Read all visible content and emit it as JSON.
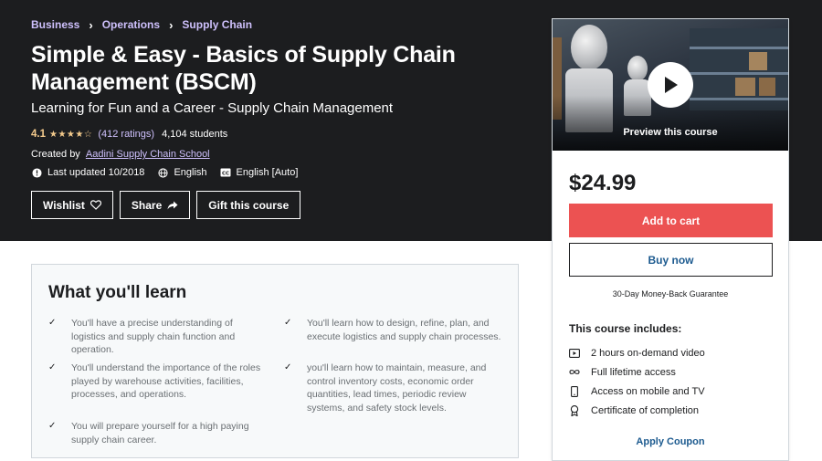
{
  "breadcrumb": [
    {
      "label": "Business"
    },
    {
      "label": "Operations"
    },
    {
      "label": "Supply Chain"
    }
  ],
  "course": {
    "title": "Simple & Easy - Basics of Supply Chain Management (BSCM)",
    "subtitle": "Learning for Fun and a Career - Supply Chain Management",
    "rating": "4.1",
    "stars": "★★★★☆",
    "ratings_count": "(412 ratings)",
    "students": "4,104 students",
    "created_by_label": "Created by",
    "instructor": "Aadini Supply Chain School",
    "last_updated": "Last updated 10/2018",
    "language": "English",
    "captions": "English [Auto]"
  },
  "hero_buttons": {
    "wishlist": "Wishlist",
    "share": "Share",
    "gift": "Gift this course"
  },
  "sidebar": {
    "preview_label": "Preview this course",
    "price": "$24.99",
    "add_to_cart": "Add to cart",
    "buy_now": "Buy now",
    "guarantee": "30-Day Money-Back Guarantee",
    "includes_title": "This course includes:",
    "includes": [
      {
        "icon": "video-icon",
        "label": "2 hours on-demand video"
      },
      {
        "icon": "infinity-icon",
        "label": "Full lifetime access"
      },
      {
        "icon": "mobile-icon",
        "label": "Access on mobile and TV"
      },
      {
        "icon": "certificate-icon",
        "label": "Certificate of completion"
      }
    ],
    "apply_coupon": "Apply Coupon"
  },
  "learn": {
    "title": "What you'll learn",
    "items": [
      "You'll have a precise understanding of logistics and supply chain function and operation.",
      "You'll learn how to design, refine, plan, and execute logistics and supply chain processes.",
      "You'll understand the importance of the roles played by warehouse activities, facilities, processes, and operations.",
      "you'll learn how to maintain, measure, and control inventory costs, economic order quantities, lead times, periodic review systems, and safety stock levels.",
      "You will prepare yourself for a high paying supply chain career."
    ]
  },
  "colors": {
    "hero_bg": "#1c1d1f",
    "accent_link": "#cec0fc",
    "star": "#f3ca8c",
    "cart_button": "#ec5252",
    "buy_link": "#1c5a8f"
  }
}
